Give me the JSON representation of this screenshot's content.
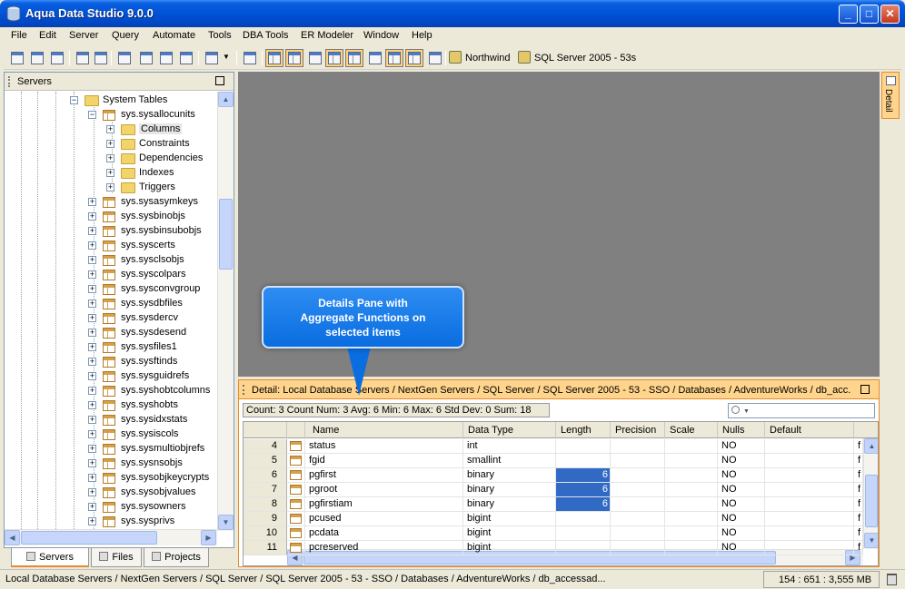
{
  "window": {
    "title": "Aqua Data Studio 9.0.0"
  },
  "menu": [
    "File",
    "Edit",
    "Server",
    "Query",
    "Automate",
    "Tools",
    "DBA Tools",
    "ER Modeler",
    "Window",
    "Help"
  ],
  "toolbar": {
    "db_label": "Northwind",
    "server_label": "SQL Server 2005 - 53s"
  },
  "left_panel": {
    "title": "Servers",
    "tree": [
      {
        "label": "System Tables",
        "type": "folder",
        "depth": 3,
        "expanded": true
      },
      {
        "label": "sys.sysallocunits",
        "type": "table",
        "depth": 4,
        "expanded": true
      },
      {
        "label": "Columns",
        "type": "folder",
        "depth": 5,
        "selected": true
      },
      {
        "label": "Constraints",
        "type": "folder",
        "depth": 5
      },
      {
        "label": "Dependencies",
        "type": "folder",
        "depth": 5
      },
      {
        "label": "Indexes",
        "type": "folder",
        "depth": 5
      },
      {
        "label": "Triggers",
        "type": "folder",
        "depth": 5
      },
      {
        "label": "sys.sysasymkeys",
        "type": "table",
        "depth": 4
      },
      {
        "label": "sys.sysbinobjs",
        "type": "table",
        "depth": 4
      },
      {
        "label": "sys.sysbinsubobjs",
        "type": "table",
        "depth": 4
      },
      {
        "label": "sys.syscerts",
        "type": "table",
        "depth": 4
      },
      {
        "label": "sys.sysclsobjs",
        "type": "table",
        "depth": 4
      },
      {
        "label": "sys.syscolpars",
        "type": "table",
        "depth": 4
      },
      {
        "label": "sys.sysconvgroup",
        "type": "table",
        "depth": 4
      },
      {
        "label": "sys.sysdbfiles",
        "type": "table",
        "depth": 4
      },
      {
        "label": "sys.sysdercv",
        "type": "table",
        "depth": 4
      },
      {
        "label": "sys.sysdesend",
        "type": "table",
        "depth": 4
      },
      {
        "label": "sys.sysfiles1",
        "type": "table",
        "depth": 4
      },
      {
        "label": "sys.sysftinds",
        "type": "table",
        "depth": 4
      },
      {
        "label": "sys.sysguidrefs",
        "type": "table",
        "depth": 4
      },
      {
        "label": "sys.syshobtcolumns",
        "type": "table",
        "depth": 4
      },
      {
        "label": "sys.syshobts",
        "type": "table",
        "depth": 4
      },
      {
        "label": "sys.sysidxstats",
        "type": "table",
        "depth": 4
      },
      {
        "label": "sys.sysiscols",
        "type": "table",
        "depth": 4
      },
      {
        "label": "sys.sysmultiobjrefs",
        "type": "table",
        "depth": 4
      },
      {
        "label": "sys.sysnsobjs",
        "type": "table",
        "depth": 4
      },
      {
        "label": "sys.sysobjkeycrypts",
        "type": "table",
        "depth": 4
      },
      {
        "label": "sys.sysobjvalues",
        "type": "table",
        "depth": 4
      },
      {
        "label": "sys.sysowners",
        "type": "table",
        "depth": 4
      },
      {
        "label": "sys.sysprivs",
        "type": "table",
        "depth": 4
      }
    ],
    "tabs": [
      "Servers",
      "Files",
      "Projects"
    ]
  },
  "right_strip": {
    "detail_tab": "Detail"
  },
  "callout": {
    "line1": "Details Pane with",
    "line2": "Aggregate Functions on",
    "line3": "selected items"
  },
  "detail": {
    "header": "Detail: Local Database Servers / NextGen Servers / SQL Server / SQL Server 2005 - 53 - SSO / Databases / AdventureWorks / db_acc...",
    "aggregates": "Count: 3  Count Num: 3  Avg: 6  Min: 6  Max: 6  Std Dev: 0  Sum: 18",
    "columns": [
      "Name",
      "Data Type",
      "Length",
      "Precision",
      "Scale",
      "Nulls",
      "Default"
    ],
    "rows": [
      {
        "num": "4",
        "name": "status",
        "type": "int",
        "length": "",
        "nulls": "NO",
        "extra": "f"
      },
      {
        "num": "5",
        "name": "fgid",
        "type": "smallint",
        "length": "",
        "nulls": "NO",
        "extra": "f"
      },
      {
        "num": "6",
        "name": "pgfirst",
        "type": "binary",
        "length": "6",
        "nulls": "NO",
        "extra": "f",
        "hl": true
      },
      {
        "num": "7",
        "name": "pgroot",
        "type": "binary",
        "length": "6",
        "nulls": "NO",
        "extra": "f",
        "hl": true
      },
      {
        "num": "8",
        "name": "pgfirstiam",
        "type": "binary",
        "length": "6",
        "nulls": "NO",
        "extra": "f",
        "hl": true
      },
      {
        "num": "9",
        "name": "pcused",
        "type": "bigint",
        "length": "",
        "nulls": "NO",
        "extra": "f"
      },
      {
        "num": "10",
        "name": "pcdata",
        "type": "bigint",
        "length": "",
        "nulls": "NO",
        "extra": "f"
      },
      {
        "num": "11",
        "name": "pcreserved",
        "type": "bigint",
        "length": "",
        "nulls": "NO",
        "extra": "f"
      }
    ]
  },
  "status": {
    "path": "Local Database Servers / NextGen Servers / SQL Server / SQL Server 2005 - 53 - SSO / Databases / AdventureWorks / db_accessad...",
    "memory": "154 : 651 : 3,555 MB"
  }
}
